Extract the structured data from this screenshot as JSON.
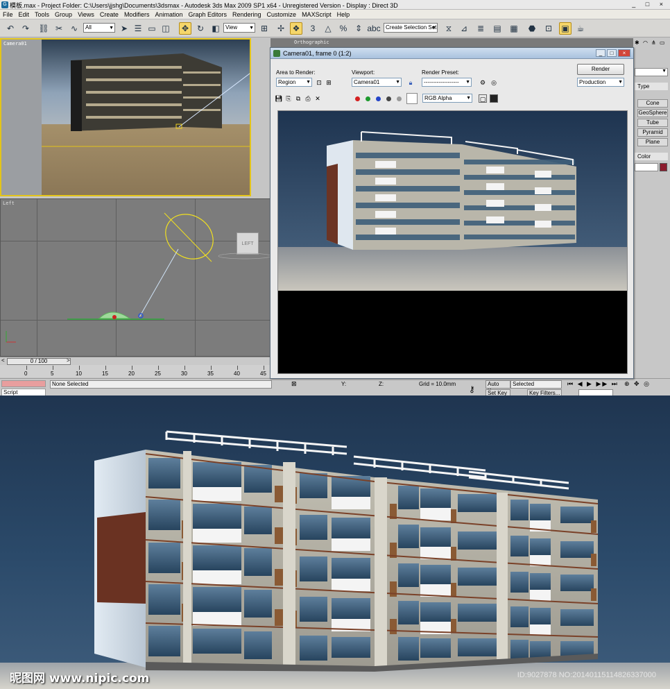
{
  "window": {
    "title": "模板.max    - Project Folder: C:\\Users\\jjshg\\Documents\\3dsmax     - Autodesk 3ds Max  2009 SP1  x64   - Unregistered Version     - Display : Direct 3D",
    "controls": "_ □ ×"
  },
  "menu": [
    "File",
    "Edit",
    "Tools",
    "Group",
    "Views",
    "Create",
    "Modifiers",
    "Animation",
    "Graph Editors",
    "Rendering",
    "Customize",
    "MAXScript",
    "Help"
  ],
  "toolbar": {
    "selection_filter": "All",
    "reference_coord": "View",
    "named_selection_placeholder": "Create Selection Set"
  },
  "viewports": {
    "camera_label": "Camera01",
    "left_label": "Left",
    "ortho_label": "Orthographic",
    "viewcube_label": "LEFT"
  },
  "timeline": {
    "slider": "0 / 100",
    "ticks": [
      "0",
      "5",
      "10",
      "15",
      "20",
      "25",
      "30",
      "35",
      "40",
      "45"
    ]
  },
  "status": {
    "selection": "None Selected",
    "script_label": "Script",
    "coord_y": "Y:",
    "coord_z": "Z:",
    "grid": "Grid = 10.0mm",
    "auto_key": "Auto Key",
    "key_mode": "Selected",
    "set_key": "Set Key",
    "key_filters": "Key Filters..."
  },
  "command_panel": {
    "buttons": [
      "Cone",
      "GeoSphere",
      "Tube",
      "Pyramid",
      "Plane"
    ],
    "rollout_type": "Type",
    "rollout_color": "Color",
    "color_swatch": "#8b1a2c"
  },
  "render_window": {
    "title": "Camera01, frame 0 (1:2)",
    "area_label": "Area to Render:",
    "area_value": "Region",
    "viewport_label": "Viewport:",
    "viewport_value": "Camera01",
    "preset_label": "Render Preset:",
    "preset_value": "-------------------",
    "render_button": "Render",
    "production_value": "Production",
    "channel_value": "RGB Alpha",
    "channel_colors": [
      "#d42020",
      "#1e9a2e",
      "#2545c8",
      "#444444",
      "#9a9a9a"
    ]
  },
  "watermark": {
    "left": "昵图网 www.nipic.com",
    "right": "ID:9027878 NO:20140115114826337000"
  }
}
